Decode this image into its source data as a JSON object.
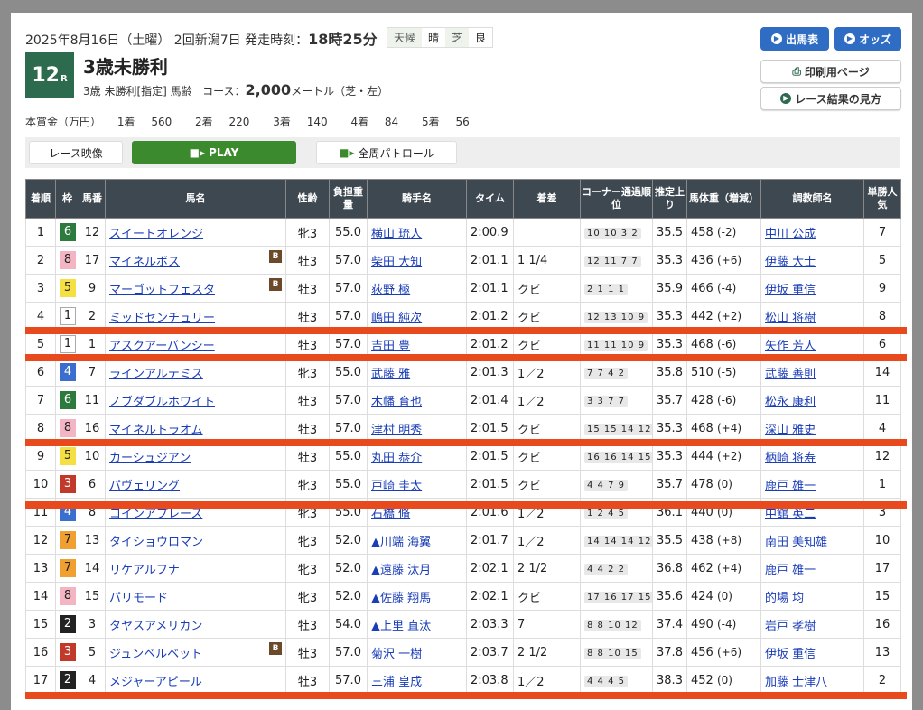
{
  "header": {
    "date_text": "2025年8月16日（土曜） 2回新潟7日  発走時刻：",
    "start_time": "18時25分",
    "weather_label": "天候",
    "weather_value": "晴",
    "track_label": "芝",
    "track_value": "良",
    "race_number": "12",
    "race_suffix": "R",
    "race_name": "3歳未勝利",
    "conditions": "3歳  未勝利[指定]  馬齢",
    "course_label": "コース：",
    "distance": "2,000",
    "course_detail": "メートル（芝・左）"
  },
  "prize": {
    "label": "本賞金（万円）",
    "items": [
      "1着",
      "560",
      "2着",
      "220",
      "3着",
      "140",
      "4着",
      "84",
      "5着",
      "56"
    ]
  },
  "buttons": {
    "horses": "出馬表",
    "odds": "オッズ",
    "print": "印刷用ページ",
    "howto": "レース結果の見方"
  },
  "video": {
    "label": "レース映像",
    "play": "PLAY",
    "patrol": "全周パトロール"
  },
  "table": {
    "headers": [
      "着順",
      "枠",
      "馬番",
      "馬名",
      "性齢",
      "負担重量",
      "騎手名",
      "タイム",
      "着差",
      "コーナー通過順位",
      "推定上り",
      "馬体重（増減）",
      "調教師名",
      "単勝人気"
    ],
    "rows": [
      {
        "pos": "1",
        "waku": "6",
        "num": "12",
        "name": "スイートオレンジ",
        "blink": "",
        "sex": "牝3",
        "wt": "55.0",
        "jockey": "横山 琉人",
        "time": "2:00.9",
        "margin": "",
        "corner": "10 10 3 2",
        "agari": "35.5",
        "bw": "458",
        "bwd": "(-2)",
        "trainer": "中川 公成",
        "pop": "7"
      },
      {
        "pos": "2",
        "waku": "8",
        "num": "17",
        "name": "マイネルボス",
        "blink": "B",
        "sex": "牡3",
        "wt": "57.0",
        "jockey": "柴田 大知",
        "time": "2:01.1",
        "margin": "1 1/4",
        "corner": "12 11 7 7",
        "agari": "35.3",
        "bw": "436",
        "bwd": "(+6)",
        "trainer": "伊藤 大士",
        "pop": "5"
      },
      {
        "pos": "3",
        "waku": "5",
        "num": "9",
        "name": "マーゴットフェスタ",
        "blink": "B",
        "sex": "牡3",
        "wt": "57.0",
        "jockey": "荻野 極",
        "time": "2:01.1",
        "margin": "クビ",
        "corner": "2 1 1 1",
        "agari": "35.9",
        "bw": "466",
        "bwd": "(-4)",
        "trainer": "伊坂 重信",
        "pop": "9"
      },
      {
        "pos": "4",
        "waku": "1",
        "num": "2",
        "name": "ミッドセンチュリー",
        "blink": "",
        "sex": "牡3",
        "wt": "57.0",
        "jockey": "嶋田 純次",
        "time": "2:01.2",
        "margin": "クビ",
        "corner": "12 13 10 9",
        "agari": "35.3",
        "bw": "442",
        "bwd": "(+2)",
        "trainer": "松山 将樹",
        "pop": "8"
      },
      {
        "pos": "5",
        "waku": "1",
        "num": "1",
        "name": "アスクアーバンシー",
        "blink": "",
        "sex": "牡3",
        "wt": "57.0",
        "jockey": "吉田 豊",
        "time": "2:01.2",
        "margin": "クビ",
        "corner": "11 11 10 9",
        "agari": "35.3",
        "bw": "468",
        "bwd": "(-6)",
        "trainer": "矢作 芳人",
        "pop": "6"
      },
      {
        "pos": "6",
        "waku": "4",
        "num": "7",
        "name": "ラインアルテミス",
        "blink": "",
        "sex": "牝3",
        "wt": "55.0",
        "jockey": "武藤 雅",
        "time": "2:01.3",
        "margin": "1／2",
        "corner": "7 7 4 2",
        "agari": "35.8",
        "bw": "510",
        "bwd": "(-5)",
        "trainer": "武藤 善則",
        "pop": "14"
      },
      {
        "pos": "7",
        "waku": "6",
        "num": "11",
        "name": "ノブダブルホワイト",
        "blink": "",
        "sex": "牡3",
        "wt": "57.0",
        "jockey": "木幡 育也",
        "time": "2:01.4",
        "margin": "1／2",
        "corner": "3 3 7 7",
        "agari": "35.7",
        "bw": "428",
        "bwd": "(-6)",
        "trainer": "松永 康利",
        "pop": "11"
      },
      {
        "pos": "8",
        "waku": "8",
        "num": "16",
        "name": "マイネルトラオム",
        "blink": "",
        "sex": "牡3",
        "wt": "57.0",
        "jockey": "津村 明秀",
        "time": "2:01.5",
        "margin": "クビ",
        "corner": "15 15 14 12",
        "agari": "35.3",
        "bw": "468",
        "bwd": "(+4)",
        "trainer": "深山 雅史",
        "pop": "4"
      },
      {
        "pos": "9",
        "waku": "5",
        "num": "10",
        "name": "カーシュジアン",
        "blink": "",
        "sex": "牡3",
        "wt": "55.0",
        "jockey": "丸田 恭介",
        "time": "2:01.5",
        "margin": "クビ",
        "corner": "16 16 14 15",
        "agari": "35.3",
        "bw": "444",
        "bwd": "(+2)",
        "trainer": "柄崎 将寿",
        "pop": "12"
      },
      {
        "pos": "10",
        "waku": "3",
        "num": "6",
        "name": "パヴェリング",
        "blink": "",
        "sex": "牝3",
        "wt": "55.0",
        "jockey": "戸崎 圭太",
        "time": "2:01.5",
        "margin": "クビ",
        "corner": "4 4 7 9",
        "agari": "35.7",
        "bw": "478",
        "bwd": "(0)",
        "trainer": "鹿戸 雄一",
        "pop": "1"
      },
      {
        "pos": "11",
        "waku": "4",
        "num": "8",
        "name": "コインアプレース",
        "blink": "",
        "sex": "牝3",
        "wt": "55.0",
        "jockey": "石橋 脩",
        "time": "2:01.6",
        "margin": "1／2",
        "corner": "1 2 4 5",
        "agari": "36.1",
        "bw": "440",
        "bwd": "(0)",
        "trainer": "中舘 英二",
        "pop": "3"
      },
      {
        "pos": "12",
        "waku": "7",
        "num": "13",
        "name": "タイショウロマン",
        "blink": "",
        "sex": "牝3",
        "wt": "52.0",
        "jockey": "▲川端 海翼",
        "time": "2:01.7",
        "margin": "1／2",
        "corner": "14 14 14 12",
        "agari": "35.5",
        "bw": "438",
        "bwd": "(+8)",
        "trainer": "南田 美知雄",
        "pop": "10"
      },
      {
        "pos": "13",
        "waku": "7",
        "num": "14",
        "name": "リケアルフナ",
        "blink": "",
        "sex": "牝3",
        "wt": "52.0",
        "jockey": "▲遠藤 汰月",
        "time": "2:02.1",
        "margin": "2 1/2",
        "corner": "4 4 2 2",
        "agari": "36.8",
        "bw": "462",
        "bwd": "(+4)",
        "trainer": "鹿戸 雄一",
        "pop": "17"
      },
      {
        "pos": "14",
        "waku": "8",
        "num": "15",
        "name": "パリモード",
        "blink": "",
        "sex": "牝3",
        "wt": "52.0",
        "jockey": "▲佐藤 翔馬",
        "time": "2:02.1",
        "margin": "クビ",
        "corner": "17 16 17 15",
        "agari": "35.6",
        "bw": "424",
        "bwd": "(0)",
        "trainer": "的場 均",
        "pop": "15"
      },
      {
        "pos": "15",
        "waku": "2",
        "num": "3",
        "name": "タヤスアメリカン",
        "blink": "",
        "sex": "牡3",
        "wt": "54.0",
        "jockey": "▲上里 直汰",
        "time": "2:03.3",
        "margin": "7",
        "corner": "8 8 10 12",
        "agari": "37.4",
        "bw": "490",
        "bwd": "(-4)",
        "trainer": "岩戸 孝樹",
        "pop": "16"
      },
      {
        "pos": "16",
        "waku": "3",
        "num": "5",
        "name": "ジュンベルベット",
        "blink": "B",
        "sex": "牡3",
        "wt": "57.0",
        "jockey": "菊沢 一樹",
        "time": "2:03.7",
        "margin": "2 1/2",
        "corner": "8 8 10 15",
        "agari": "37.8",
        "bw": "456",
        "bwd": "(+6)",
        "trainer": "伊坂 重信",
        "pop": "13"
      },
      {
        "pos": "17",
        "waku": "2",
        "num": "4",
        "name": "メジャーアピール",
        "blink": "",
        "sex": "牡3",
        "wt": "57.0",
        "jockey": "三浦 皇成",
        "time": "2:03.8",
        "margin": "1／2",
        "corner": "4 4 4 5",
        "agari": "38.3",
        "bw": "452",
        "bwd": "(0)",
        "trainer": "加藤 士津八",
        "pop": "2"
      }
    ]
  },
  "colors": {
    "header_bg": "#3d4851",
    "race_badge": "#2d6b4f",
    "accent_blue": "#2f6dc4",
    "play_green": "#3c8a2e",
    "overlay_red": "#e84a1e"
  }
}
